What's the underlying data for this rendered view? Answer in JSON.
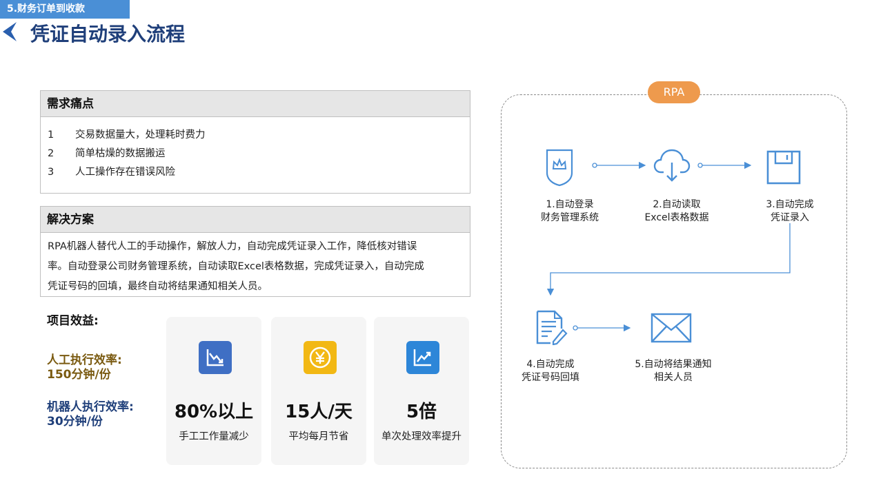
{
  "header": {
    "section_tag": "5.财务订单到收款",
    "title": "凭证自动录入流程"
  },
  "pain_points": {
    "heading": "需求痛点",
    "items": [
      {
        "num": "1",
        "text": "交易数据量大，处理耗时费力"
      },
      {
        "num": "2",
        "text": "简单枯燥的数据搬运"
      },
      {
        "num": "3",
        "text": "人工操作存在错误风险"
      }
    ]
  },
  "solution": {
    "heading": "解决方案",
    "lines": [
      "RPA机器人替代人工的手动操作，解放人力，自动完成凭证录入工作，降低核对错误",
      "率。自动登录公司财务管理系统，自动读取Excel表格数据，完成凭证录入，自动完成",
      "凭证号码的回填，最终自动将结果通知相关人员。"
    ]
  },
  "benefits": {
    "heading": "项目效益:",
    "manual_efficiency": {
      "label": "人工执行效率:",
      "value": "150分钟/份",
      "color": "#7a5a10"
    },
    "robot_efficiency": {
      "label": "机器人执行效率:",
      "value": "30分钟/份",
      "color": "#1f3f7a"
    },
    "cards": [
      {
        "icon": "chart-down-icon",
        "color": "#3f6fc4",
        "value": "80%以上",
        "desc": "手工工作量减少"
      },
      {
        "icon": "yen-coin-icon",
        "color": "#f2b814",
        "value": "15人/天",
        "desc": "平均每月节省"
      },
      {
        "icon": "chart-up-icon",
        "color": "#2d86d8",
        "value": "5倍",
        "desc": "单次处理效率提升"
      }
    ]
  },
  "rpa": {
    "badge": "RPA",
    "steps": [
      {
        "icon": "shield-crown-icon",
        "line1": "1.自动登录",
        "line2": "财务管理系统"
      },
      {
        "icon": "cloud-download-icon",
        "line1": "2.自动读取",
        "line2": "Excel表格数据"
      },
      {
        "icon": "save-icon",
        "line1": "3.自动完成",
        "line2": "凭证录入"
      },
      {
        "icon": "document-edit-icon",
        "line1": "4.自动完成",
        "line2": "凭证号码回填"
      },
      {
        "icon": "mail-icon",
        "line1": "5.自动将结果通知",
        "line2": "相关人员"
      }
    ],
    "accent_color": "#4a8fd6"
  }
}
